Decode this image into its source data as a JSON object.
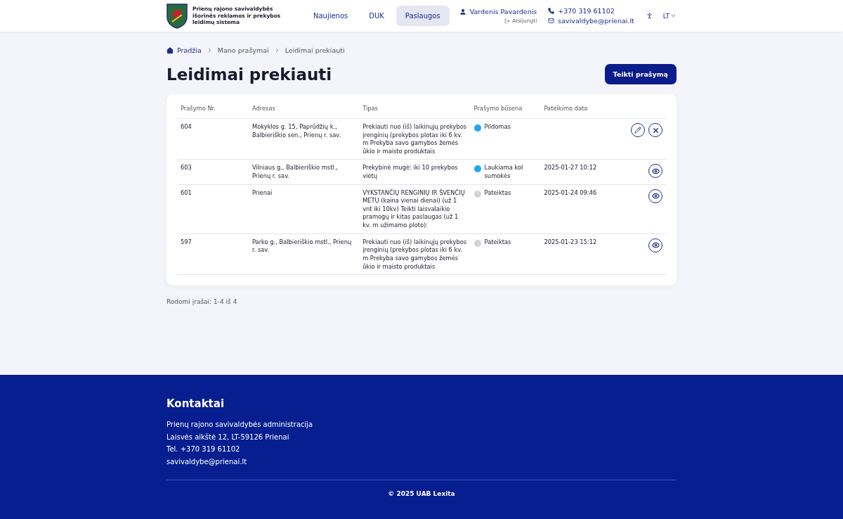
{
  "header": {
    "site_title": "Prienų rajono savivaldybės išorinės reklamos ir prekybos leidimų sistema",
    "nav": [
      {
        "label": "Naujienos",
        "selected": false
      },
      {
        "label": "DUK",
        "selected": false
      },
      {
        "label": "Paslaugos",
        "selected": true
      }
    ],
    "user": {
      "name": "Vardenis Pavardenis",
      "logout": "Atsijungti"
    },
    "phone": "+370 319 61102",
    "email": "savivaldybe@prienai.lt",
    "language": "LT"
  },
  "breadcrumb": [
    "Pradžia",
    "Mano prašymai",
    "Leidimai prekiauti"
  ],
  "page_title": "Leidimai prekiauti",
  "primary_button": "Teikti prašymą",
  "table": {
    "columns": [
      "Prašymo Nr.",
      "Adresas",
      "Tipas",
      "Prašymo būsena",
      "Pateikimo data"
    ],
    "rows": [
      {
        "number": "604",
        "address": "Mokyklos g. 15, Paprūdžių k., Balbieriškio sen., Prienų r. sav.",
        "type": "Prekiauti nuo (iš) laikinųjų prekybos įrenginių (prekybos plotas iki 6 kv. m Prekyba savo gamybos žemės ūkio ir maisto produktais",
        "status": "Pildomas",
        "color": "#1ea7f0",
        "date": "",
        "actions": [
          {
            "kind": "edit"
          },
          {
            "kind": "cancel"
          }
        ]
      },
      {
        "number": "603",
        "address": "Vilniaus g., Balbieriškio mstl., Prienų r. sav.",
        "type": "Prekybinė mugė: iki 10 prekybos vietų",
        "status": "Laukiama kol sumokės",
        "color": "#1ea7f0",
        "date": "2025-01-27 10:12",
        "actions": [
          {
            "kind": "view"
          }
        ]
      },
      {
        "number": "601",
        "address": "Prienai",
        "type": "VYKSTANČIŲ RENGINIŲ IR ŠVENČIŲ METU (kaina vienai dienai) (už 1 vnt iki 10kv) Teikti laisvalaikio pramogų ir kitas paslaugas (už 1 kv. m užimamo ploto):",
        "status": "Pateiktas",
        "color": "#d4d4d8",
        "date": "2025-01-24 09:46",
        "actions": [
          {
            "kind": "view"
          }
        ]
      },
      {
        "number": "597",
        "address": "Parko g., Balbieriškio mstl., Prienų r. sav.",
        "type": "Prekiauti nuo (iš) laikinųjų prekybos įrenginių (prekybos plotas iki 6 kv. m Prekyba savo gamybos žemės ūkio ir maisto produktais",
        "status": "Pateiktas",
        "color": "#d4d4d8",
        "date": "2025-01-23 15:12",
        "actions": [
          {
            "kind": "view"
          }
        ]
      }
    ]
  },
  "record_count": "Rodomi įrašai: 1-4 iš 4",
  "footer": {
    "title": "Kontaktai",
    "lines": [
      "Prienų rajono savivaldybės administracija",
      "Laisvės aikštė 12, LT-59126 Prienai",
      "Tel. +370 319 61102",
      "savivaldybe@prienai.lt"
    ],
    "copyright": "© 2025 UAB Lexita"
  }
}
